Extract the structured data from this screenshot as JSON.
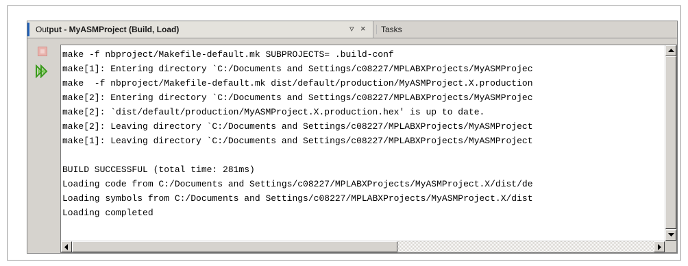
{
  "output_tab": {
    "prefix": "Out",
    "title": "put - MyASMProject (Build, Load)",
    "minimize_icon": "▿",
    "close_icon": "×"
  },
  "tasks_tab": {
    "label": "Tasks"
  },
  "toolbar": {
    "stop_icon": "stop-icon",
    "rerun_icon": "rerun-icon"
  },
  "console": {
    "lines": [
      "make -f nbproject/Makefile-default.mk SUBPROJECTS= .build-conf",
      "make[1]: Entering directory `C:/Documents and Settings/c08227/MPLABXProjects/MyASMProjec",
      "make  -f nbproject/Makefile-default.mk dist/default/production/MyASMProject.X.production",
      "make[2]: Entering directory `C:/Documents and Settings/c08227/MPLABXProjects/MyASMProjec",
      "make[2]: `dist/default/production/MyASMProject.X.production.hex' is up to date.",
      "make[2]: Leaving directory `C:/Documents and Settings/c08227/MPLABXProjects/MyASMProject",
      "make[1]: Leaving directory `C:/Documents and Settings/c08227/MPLABXProjects/MyASMProject",
      "",
      "BUILD SUCCESSFUL (total time: 281ms)",
      "Loading code from C:/Documents and Settings/c08227/MPLABXProjects/MyASMProject.X/dist/de",
      "Loading symbols from C:/Documents and Settings/c08227/MPLABXProjects/MyASMProject.X/dist",
      "Loading completed"
    ]
  },
  "colors": {
    "rerun_icon": "#3a9a1c",
    "tab_accent": "#1f5fb8",
    "panel_bg": "#d6d3ce"
  }
}
